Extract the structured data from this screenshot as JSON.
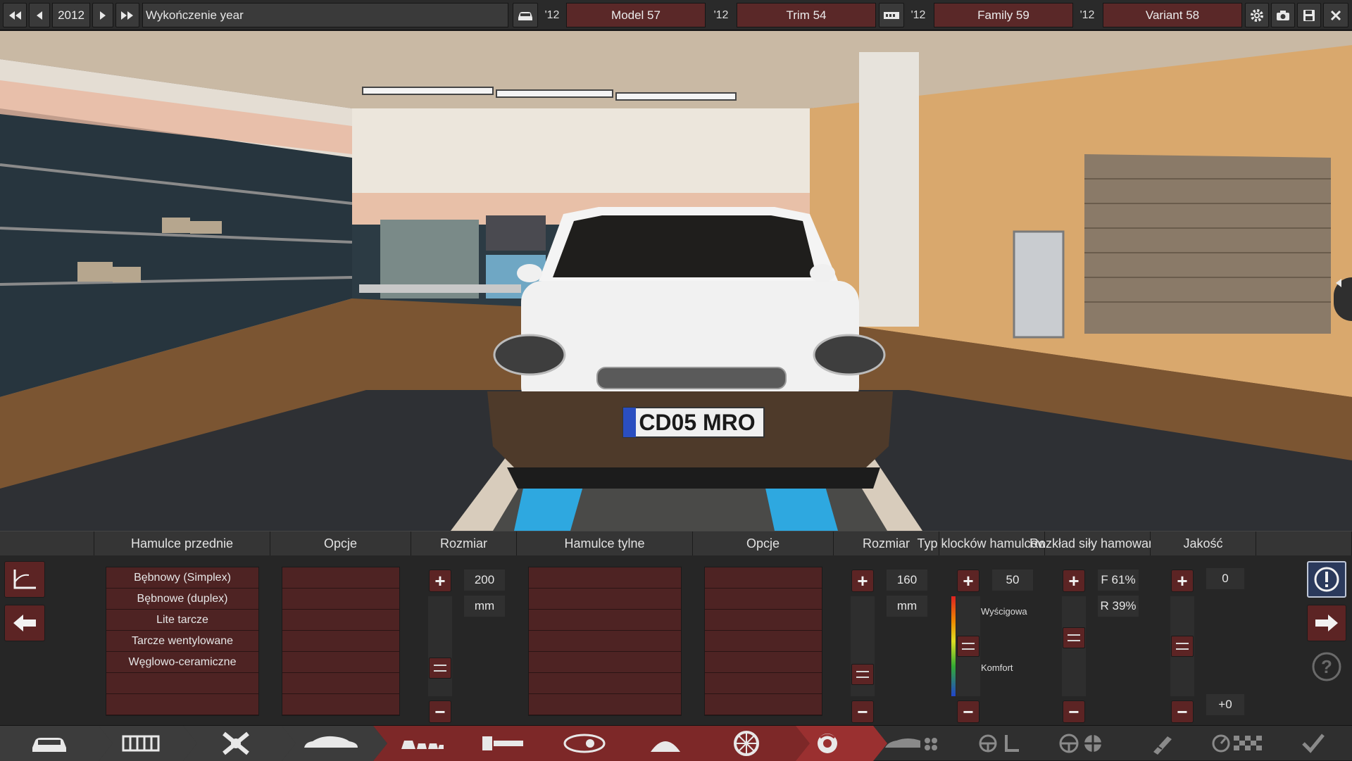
{
  "topbar": {
    "year": "2012",
    "section_label": "Wykończenie year",
    "year_short_1": "'12",
    "model": "Model 57",
    "year_short_2": "'12",
    "trim": "Trim 54",
    "year_short_3": "'12",
    "family": "Family 59",
    "year_short_4": "'12",
    "variant": "Variant 58"
  },
  "scene": {
    "license_plate": "CD05 MRO"
  },
  "panel": {
    "headers": {
      "front_brakes": "Hamulce przednie",
      "front_options": "Opcje",
      "front_size": "Rozmiar",
      "rear_brakes": "Hamulce tylne",
      "rear_options": "Opcje",
      "rear_size": "Rozmiar",
      "pad_type": "Typ klocków hamulcowych",
      "distribution": "Rozkład siły hamowania",
      "quality": "Jakość"
    },
    "front_brake_types": [
      "Bębnowy (Simplex)",
      "Bębnowe (duplex)",
      "Lite tarcze",
      "Tarcze wentylowane",
      "Węglowo-ceramiczne"
    ],
    "front_size_value": "200",
    "front_size_unit": "mm",
    "rear_size_value": "160",
    "rear_size_unit": "mm",
    "pad_value": "50",
    "pad_top_label": "Wyścigowa",
    "pad_bottom_label": "Komfort",
    "distribution_front": "F 61%",
    "distribution_rear": "R 39%",
    "quality_value": "0",
    "quality_delta": "+0",
    "front_size_level": 0.22,
    "rear_size_level": 0.14,
    "pad_level": 0.5,
    "distribution_level": 0.61,
    "quality_level": 0.5
  },
  "colors": {
    "accent": "#5c2424",
    "active_nav": "#8a2b2b"
  },
  "nav_icons": [
    "car-body-icon",
    "chassis-frame-icon",
    "suspension-icon",
    "car-side-icon",
    "car-models-icon",
    "engine-icon",
    "headlight-icon",
    "fixture-icon",
    "wheel-icon",
    "brake-icon",
    "aero-icon",
    "interior-icon",
    "steering-icon",
    "tuning-icon",
    "test-track-icon",
    "finish-icon"
  ]
}
